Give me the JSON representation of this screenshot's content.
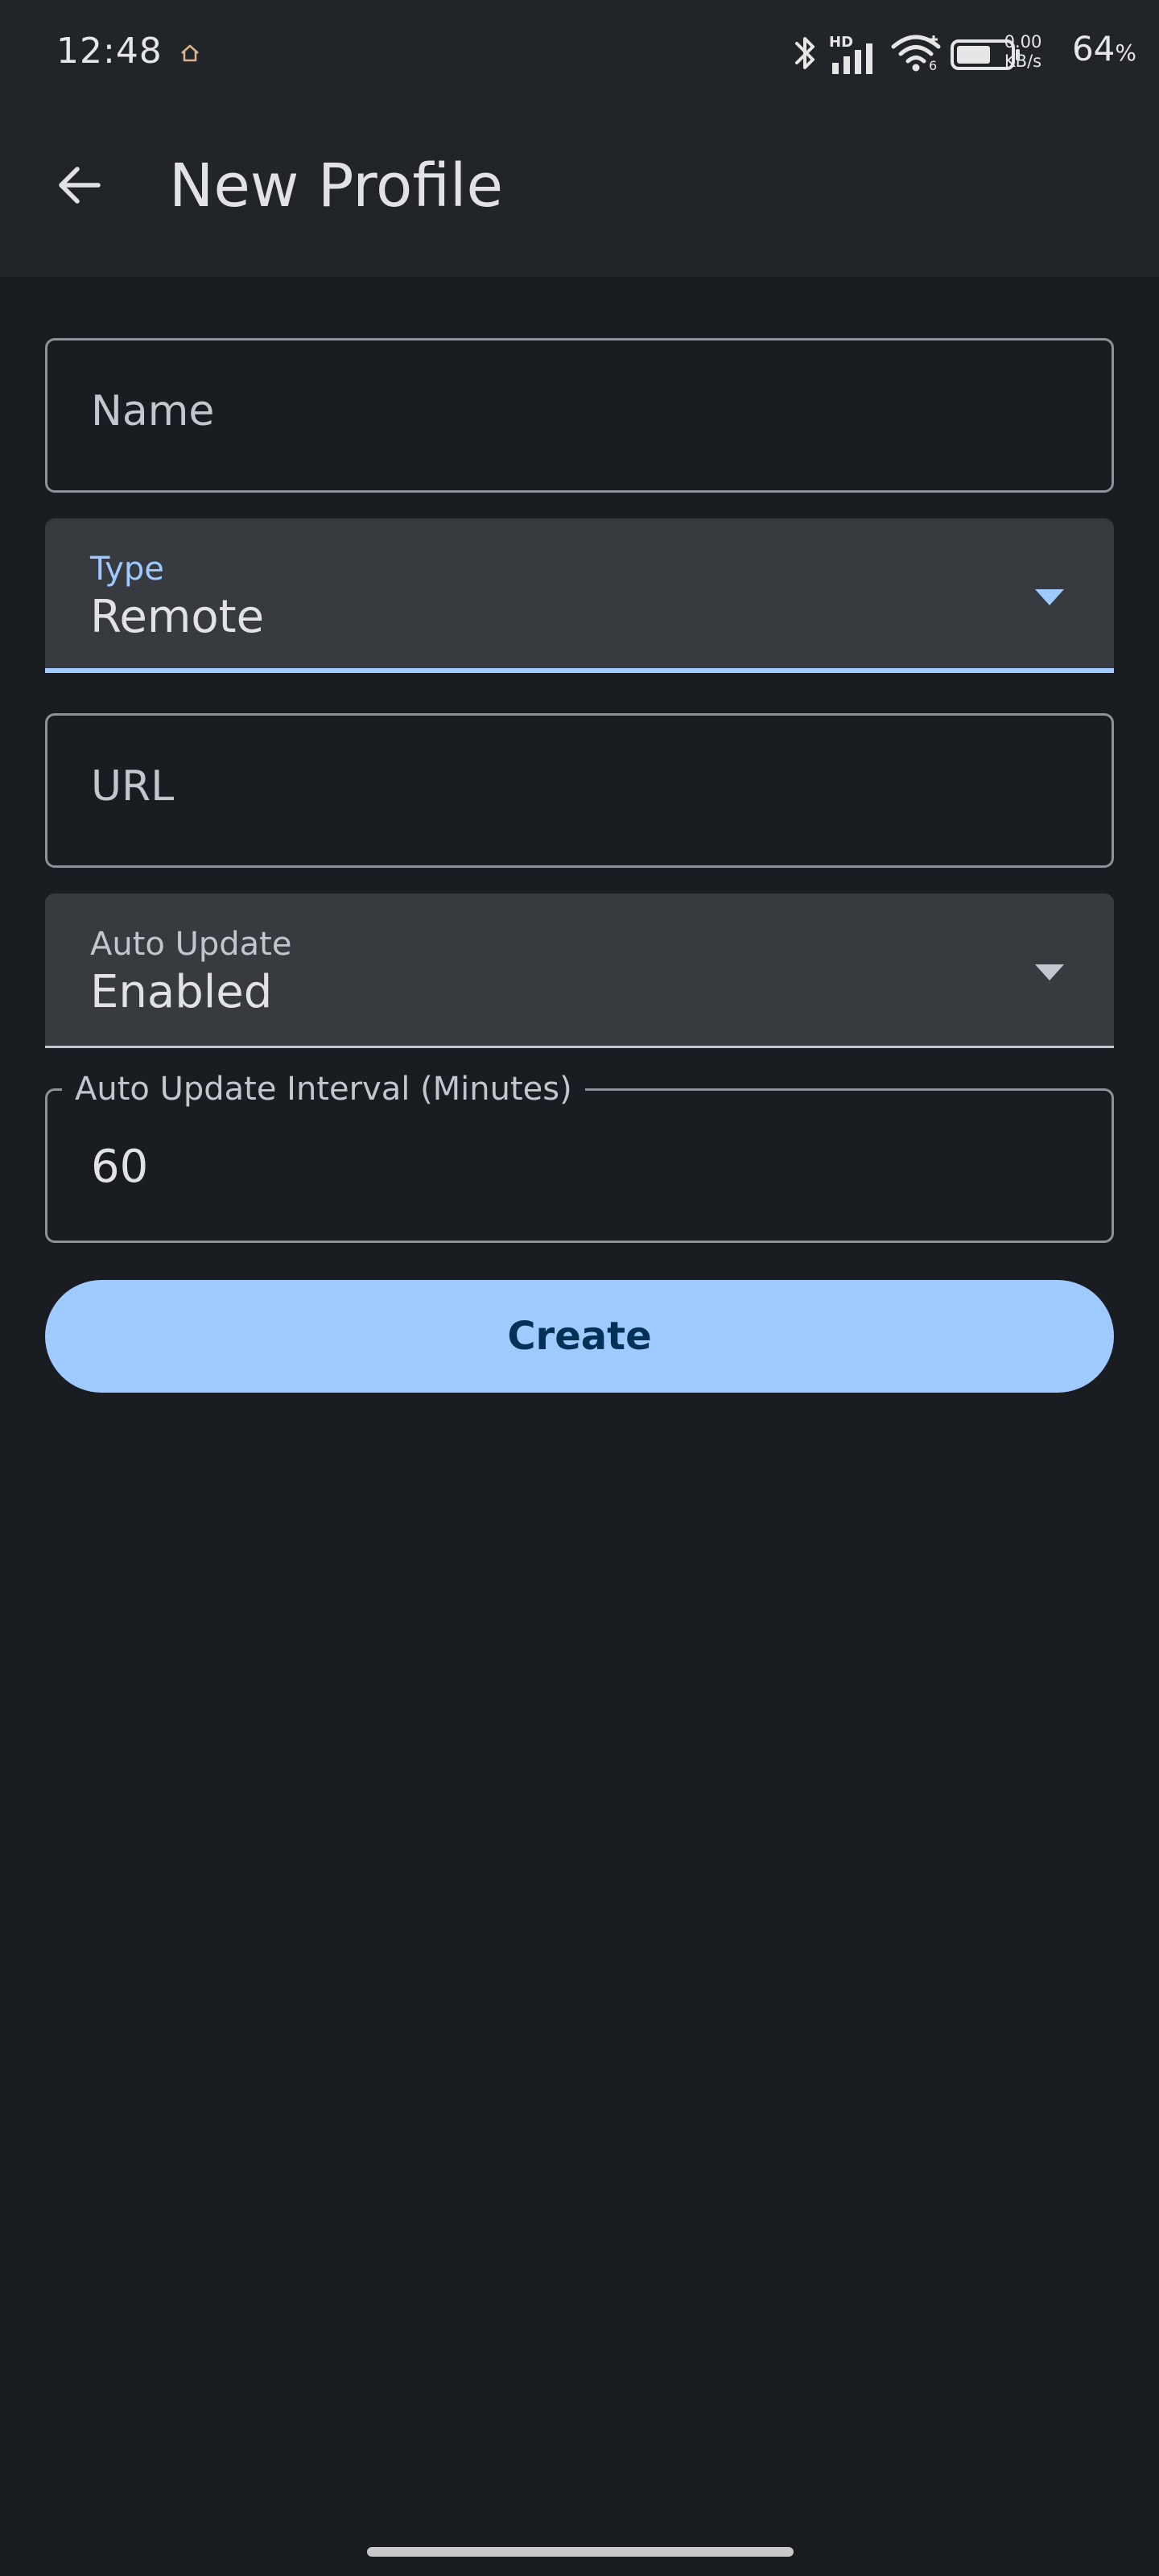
{
  "status_bar": {
    "time": "12:48",
    "net_speed_value": "0.00",
    "net_speed_unit": "KB/s",
    "network_badge": "HD",
    "wifi_badge": "6",
    "battery_percent": "64",
    "battery_percent_sign": "%",
    "battery_level": 0.64,
    "icons": [
      "home-icon",
      "bluetooth-icon",
      "signal-icon",
      "wifi-icon",
      "battery-icon"
    ]
  },
  "app_bar": {
    "back_icon": "arrow-back-icon",
    "title": "New Profile"
  },
  "form": {
    "name": {
      "placeholder": "Name"
    },
    "type": {
      "label": "Type",
      "value": "Remote"
    },
    "url": {
      "placeholder": "URL"
    },
    "auto_update": {
      "label": "Auto Update",
      "value": "Enabled"
    },
    "interval": {
      "label": "Auto Update Interval (Minutes)",
      "value": "60"
    },
    "create_label": "Create"
  },
  "colors": {
    "background": "#191c20",
    "app_bar": "#212429",
    "accent": "#9ecaff",
    "filled_field": "#373a3f",
    "on_accent": "#003258"
  }
}
